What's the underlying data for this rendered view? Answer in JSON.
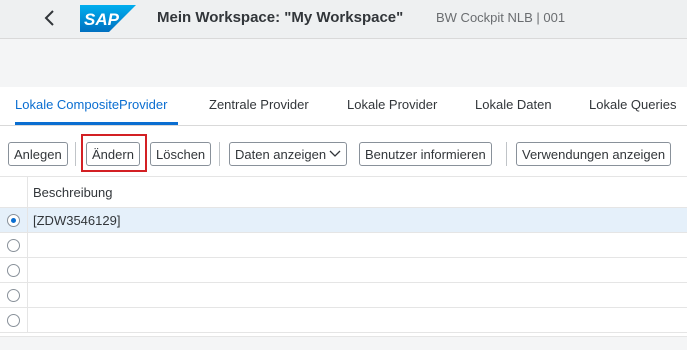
{
  "shell": {
    "title": "Mein Workspace: \"My Workspace\"",
    "subtitle": "BW Cockpit NLB | 001",
    "logo_text": "SAP",
    "brand_color": "#0a6ed1"
  },
  "tabs": [
    {
      "label": "Lokale CompositeProvider",
      "active": true
    },
    {
      "label": "Zentrale Provider",
      "active": false
    },
    {
      "label": "Lokale Provider",
      "active": false
    },
    {
      "label": "Lokale Daten",
      "active": false
    },
    {
      "label": "Lokale Queries",
      "active": false
    }
  ],
  "toolbar": {
    "create_label": "Anlegen",
    "change_label": "Ändern",
    "delete_label": "Löschen",
    "show_data_label": "Daten anzeigen",
    "notify_users_label": "Benutzer informieren",
    "where_used_label": "Verwendungen anzeigen"
  },
  "table": {
    "columns": [
      "Beschreibung"
    ],
    "rows": [
      {
        "description": "[ZDW3546129]",
        "selected": true
      },
      {
        "description": "",
        "selected": false
      },
      {
        "description": "",
        "selected": false
      },
      {
        "description": "",
        "selected": false
      },
      {
        "description": "",
        "selected": false
      }
    ]
  },
  "icons": {
    "back": "back-arrow-icon",
    "dropdown": "chevron-down-icon"
  }
}
